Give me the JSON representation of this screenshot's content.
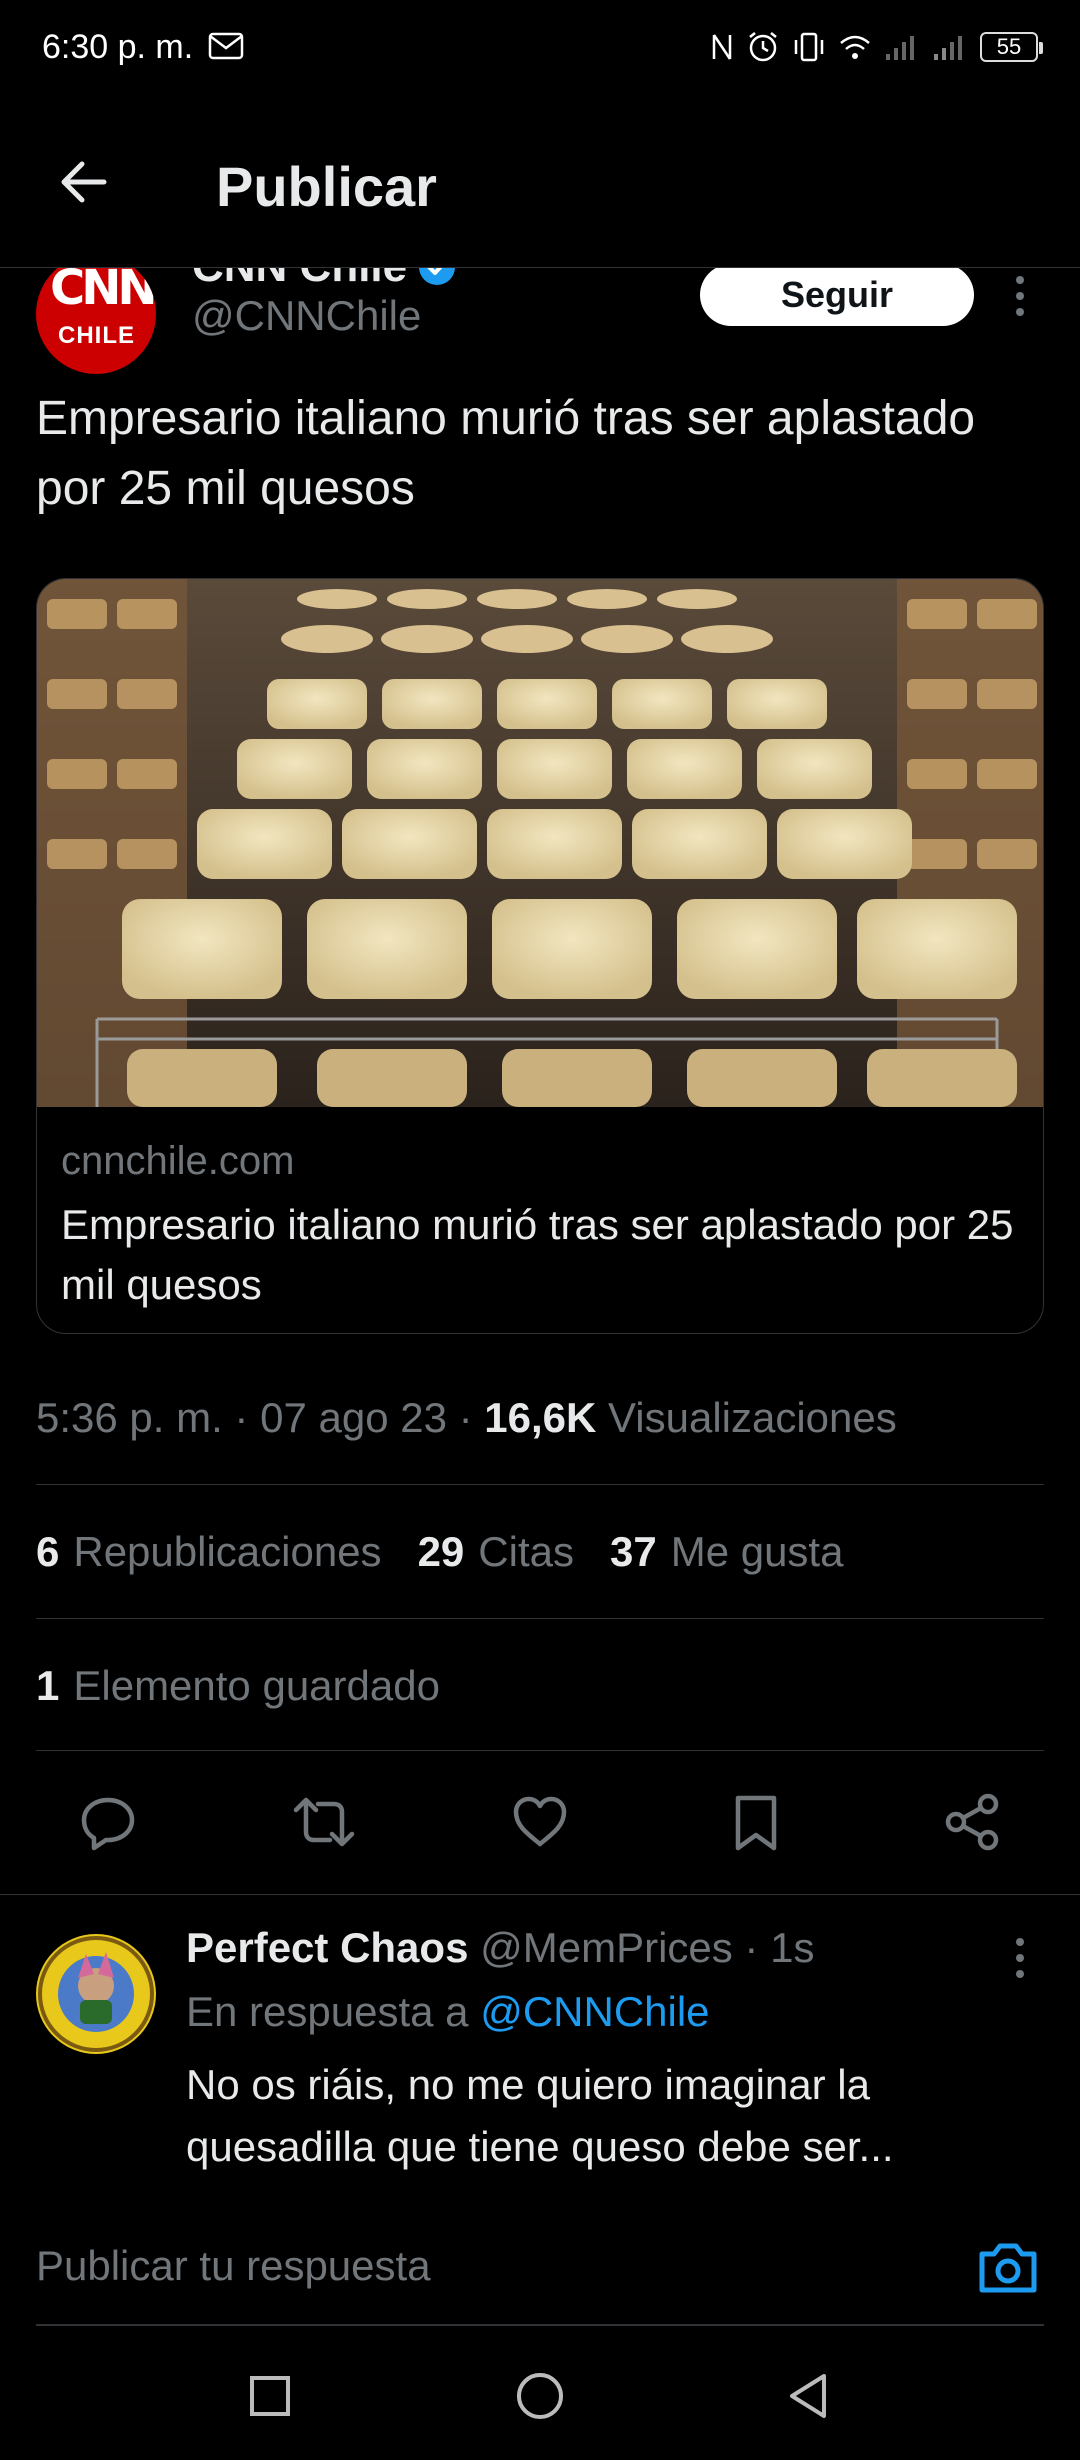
{
  "status_bar": {
    "time": "6:30 p. m.",
    "battery": "55",
    "icons": [
      "mail-icon",
      "nfc-icon",
      "alarm-icon",
      "vibrate-icon",
      "wifi-icon",
      "signal-icon",
      "signal-icon",
      "battery-icon"
    ]
  },
  "header": {
    "title": "Publicar",
    "back_icon": "back-arrow-icon"
  },
  "tweet": {
    "author_name": "CNN Chile",
    "author_handle": "@CNNChile",
    "avatar_logo": "CNN",
    "avatar_sub": "CHILE",
    "follow_label": "Seguir",
    "text": "Empresario italiano murió tras ser aplastado por 25 mil quesos",
    "card": {
      "domain": "cnnchile.com",
      "title": "Empresario italiano murió tras ser aplastado por 25 mil quesos"
    },
    "time": "5:36 p. m.",
    "date": "07 ago 23",
    "views_count": "16,6K",
    "views_label": "Visualizaciones",
    "reposts_count": "6",
    "reposts_label": "Republicaciones",
    "quotes_count": "29",
    "quotes_label": "Citas",
    "likes_count": "37",
    "likes_label": "Me gusta",
    "saved_count": "1",
    "saved_label": "Elemento guardado"
  },
  "reply": {
    "author_name": "Perfect Chaos",
    "author_handle": "@MemPrices",
    "time": "1s",
    "in_reply_prefix": "En respuesta a",
    "in_reply_mention": "@CNNChile",
    "text": "No os riáis, no me quiero imaginar la quesadilla que tiene queso debe ser..."
  },
  "compose": {
    "placeholder": "Publicar tu respuesta"
  },
  "colors": {
    "background": "#000000",
    "accent": "#1d9bf0",
    "text_primary": "#e7e9ea",
    "text_secondary": "#71767b",
    "divider": "#2f3336",
    "cnn_red": "#cc0000"
  }
}
